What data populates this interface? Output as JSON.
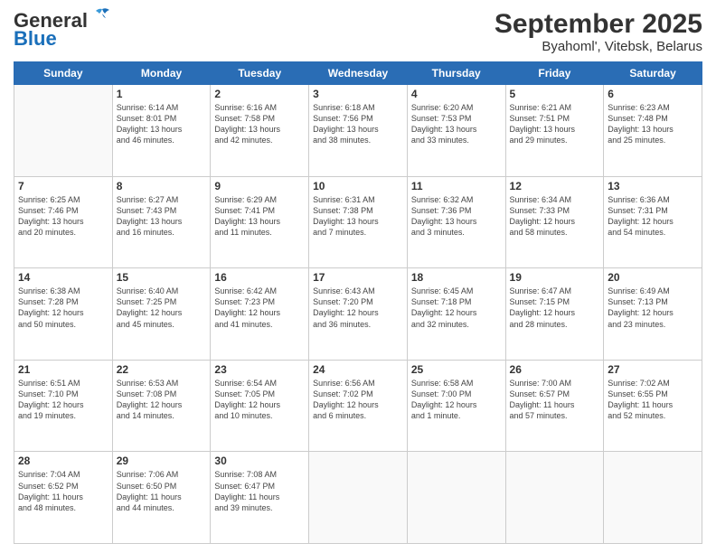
{
  "header": {
    "logo_general": "General",
    "logo_blue": "Blue",
    "title": "September 2025",
    "subtitle": "Byahoml', Vitebsk, Belarus"
  },
  "days_of_week": [
    "Sunday",
    "Monday",
    "Tuesday",
    "Wednesday",
    "Thursday",
    "Friday",
    "Saturday"
  ],
  "weeks": [
    [
      {
        "day": "",
        "info": ""
      },
      {
        "day": "1",
        "info": "Sunrise: 6:14 AM\nSunset: 8:01 PM\nDaylight: 13 hours\nand 46 minutes."
      },
      {
        "day": "2",
        "info": "Sunrise: 6:16 AM\nSunset: 7:58 PM\nDaylight: 13 hours\nand 42 minutes."
      },
      {
        "day": "3",
        "info": "Sunrise: 6:18 AM\nSunset: 7:56 PM\nDaylight: 13 hours\nand 38 minutes."
      },
      {
        "day": "4",
        "info": "Sunrise: 6:20 AM\nSunset: 7:53 PM\nDaylight: 13 hours\nand 33 minutes."
      },
      {
        "day": "5",
        "info": "Sunrise: 6:21 AM\nSunset: 7:51 PM\nDaylight: 13 hours\nand 29 minutes."
      },
      {
        "day": "6",
        "info": "Sunrise: 6:23 AM\nSunset: 7:48 PM\nDaylight: 13 hours\nand 25 minutes."
      }
    ],
    [
      {
        "day": "7",
        "info": "Sunrise: 6:25 AM\nSunset: 7:46 PM\nDaylight: 13 hours\nand 20 minutes."
      },
      {
        "day": "8",
        "info": "Sunrise: 6:27 AM\nSunset: 7:43 PM\nDaylight: 13 hours\nand 16 minutes."
      },
      {
        "day": "9",
        "info": "Sunrise: 6:29 AM\nSunset: 7:41 PM\nDaylight: 13 hours\nand 11 minutes."
      },
      {
        "day": "10",
        "info": "Sunrise: 6:31 AM\nSunset: 7:38 PM\nDaylight: 13 hours\nand 7 minutes."
      },
      {
        "day": "11",
        "info": "Sunrise: 6:32 AM\nSunset: 7:36 PM\nDaylight: 13 hours\nand 3 minutes."
      },
      {
        "day": "12",
        "info": "Sunrise: 6:34 AM\nSunset: 7:33 PM\nDaylight: 12 hours\nand 58 minutes."
      },
      {
        "day": "13",
        "info": "Sunrise: 6:36 AM\nSunset: 7:31 PM\nDaylight: 12 hours\nand 54 minutes."
      }
    ],
    [
      {
        "day": "14",
        "info": "Sunrise: 6:38 AM\nSunset: 7:28 PM\nDaylight: 12 hours\nand 50 minutes."
      },
      {
        "day": "15",
        "info": "Sunrise: 6:40 AM\nSunset: 7:25 PM\nDaylight: 12 hours\nand 45 minutes."
      },
      {
        "day": "16",
        "info": "Sunrise: 6:42 AM\nSunset: 7:23 PM\nDaylight: 12 hours\nand 41 minutes."
      },
      {
        "day": "17",
        "info": "Sunrise: 6:43 AM\nSunset: 7:20 PM\nDaylight: 12 hours\nand 36 minutes."
      },
      {
        "day": "18",
        "info": "Sunrise: 6:45 AM\nSunset: 7:18 PM\nDaylight: 12 hours\nand 32 minutes."
      },
      {
        "day": "19",
        "info": "Sunrise: 6:47 AM\nSunset: 7:15 PM\nDaylight: 12 hours\nand 28 minutes."
      },
      {
        "day": "20",
        "info": "Sunrise: 6:49 AM\nSunset: 7:13 PM\nDaylight: 12 hours\nand 23 minutes."
      }
    ],
    [
      {
        "day": "21",
        "info": "Sunrise: 6:51 AM\nSunset: 7:10 PM\nDaylight: 12 hours\nand 19 minutes."
      },
      {
        "day": "22",
        "info": "Sunrise: 6:53 AM\nSunset: 7:08 PM\nDaylight: 12 hours\nand 14 minutes."
      },
      {
        "day": "23",
        "info": "Sunrise: 6:54 AM\nSunset: 7:05 PM\nDaylight: 12 hours\nand 10 minutes."
      },
      {
        "day": "24",
        "info": "Sunrise: 6:56 AM\nSunset: 7:02 PM\nDaylight: 12 hours\nand 6 minutes."
      },
      {
        "day": "25",
        "info": "Sunrise: 6:58 AM\nSunset: 7:00 PM\nDaylight: 12 hours\nand 1 minute."
      },
      {
        "day": "26",
        "info": "Sunrise: 7:00 AM\nSunset: 6:57 PM\nDaylight: 11 hours\nand 57 minutes."
      },
      {
        "day": "27",
        "info": "Sunrise: 7:02 AM\nSunset: 6:55 PM\nDaylight: 11 hours\nand 52 minutes."
      }
    ],
    [
      {
        "day": "28",
        "info": "Sunrise: 7:04 AM\nSunset: 6:52 PM\nDaylight: 11 hours\nand 48 minutes."
      },
      {
        "day": "29",
        "info": "Sunrise: 7:06 AM\nSunset: 6:50 PM\nDaylight: 11 hours\nand 44 minutes."
      },
      {
        "day": "30",
        "info": "Sunrise: 7:08 AM\nSunset: 6:47 PM\nDaylight: 11 hours\nand 39 minutes."
      },
      {
        "day": "",
        "info": ""
      },
      {
        "day": "",
        "info": ""
      },
      {
        "day": "",
        "info": ""
      },
      {
        "day": "",
        "info": ""
      }
    ]
  ]
}
